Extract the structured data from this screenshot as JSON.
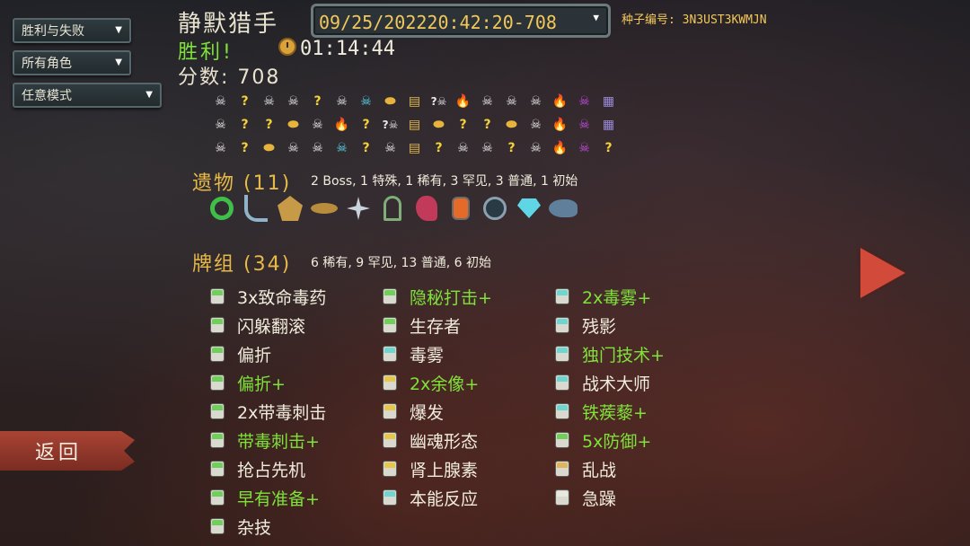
{
  "filters": {
    "result": "胜利与失败",
    "character": "所有角色",
    "mode": "任意模式"
  },
  "header": {
    "character_name": "静默猎手",
    "outcome": "胜利!",
    "score_label": "分数: 708",
    "playtime": "01:14:44",
    "run_date": "09/25/202220:42:20-708",
    "seed_label": "种子编号: 3N3UST3KWMJN"
  },
  "map_path": {
    "rows": [
      [
        "monster",
        "unknown",
        "monster",
        "monster",
        "unknown",
        "monster",
        "elite",
        "treasure",
        "chest",
        "unknown-monster",
        "rest",
        "monster",
        "monster",
        "monster",
        "rest",
        "boss",
        "shop"
      ],
      [
        "monster",
        "unknown",
        "unknown",
        "treasure",
        "monster",
        "rest",
        "unknown",
        "unknown-monster",
        "chest",
        "treasure",
        "unknown",
        "unknown",
        "treasure",
        "monster",
        "rest",
        "boss",
        "shop"
      ],
      [
        "monster",
        "unknown",
        "treasure",
        "monster",
        "monster",
        "elite",
        "unknown",
        "monster",
        "chest",
        "unknown",
        "monster",
        "monster",
        "unknown",
        "monster",
        "rest",
        "boss",
        "unknown"
      ]
    ]
  },
  "relics": {
    "title": "遗物 (11)",
    "stats": "2 Boss, 1 特殊, 1 稀有, 3 罕见, 3 普通, 1 初始",
    "icons": [
      "ring-icon",
      "anchor-icon",
      "pentagon-shield-icon",
      "sundial-icon",
      "shuriken-icon",
      "birdcage-icon",
      "tentacle-icon",
      "ember-bottle-icon",
      "orb-icon",
      "gem-icon",
      "shark-icon"
    ]
  },
  "deck": {
    "title": "牌组 (34)",
    "stats": "6 稀有, 9 罕见, 13 普通, 6 初始",
    "columns": [
      [
        {
          "name": "3x致命毒药",
          "upgraded": false,
          "icon": "g"
        },
        {
          "name": "闪躲翻滚",
          "upgraded": false,
          "icon": "g"
        },
        {
          "name": "偏折",
          "upgraded": false,
          "icon": "g"
        },
        {
          "name": "偏折+",
          "upgraded": true,
          "icon": "g"
        },
        {
          "name": "2x带毒刺击",
          "upgraded": false,
          "icon": "g"
        },
        {
          "name": "带毒刺击+",
          "upgraded": true,
          "icon": "g"
        },
        {
          "name": "抢占先机",
          "upgraded": false,
          "icon": "g"
        },
        {
          "name": "早有准备+",
          "upgraded": true,
          "icon": "g"
        },
        {
          "name": "杂技",
          "upgraded": false,
          "icon": "g"
        }
      ],
      [
        {
          "name": "隐秘打击+",
          "upgraded": true,
          "icon": "g"
        },
        {
          "name": "生存者",
          "upgraded": false,
          "icon": "g"
        },
        {
          "name": "毒雾",
          "upgraded": false,
          "icon": "t"
        },
        {
          "name": "2x余像+",
          "upgraded": true,
          "icon": "y"
        },
        {
          "name": "爆发",
          "upgraded": false,
          "icon": "y"
        },
        {
          "name": "幽魂形态",
          "upgraded": false,
          "icon": "y"
        },
        {
          "name": "肾上腺素",
          "upgraded": false,
          "icon": "y"
        },
        {
          "name": "本能反应",
          "upgraded": false,
          "icon": "t"
        }
      ],
      [
        {
          "name": "2x毒雾+",
          "upgraded": true,
          "icon": "t"
        },
        {
          "name": "残影",
          "upgraded": false,
          "icon": "t"
        },
        {
          "name": "独门技术+",
          "upgraded": true,
          "icon": "t"
        },
        {
          "name": "战术大师",
          "upgraded": false,
          "icon": "t"
        },
        {
          "name": "铁蒺藜+",
          "upgraded": true,
          "icon": "t"
        },
        {
          "name": "5x防御+",
          "upgraded": true,
          "icon": "g"
        },
        {
          "name": "乱战",
          "upgraded": false,
          "icon": "o"
        },
        {
          "name": "急躁",
          "upgraded": false,
          "icon": "w"
        }
      ]
    ]
  },
  "back_button": "返回",
  "colors": {
    "gold": "#e7b948",
    "upgraded_green": "#7fe13a",
    "date_yellow": "#f3c85a",
    "back_red": "#a94434"
  }
}
